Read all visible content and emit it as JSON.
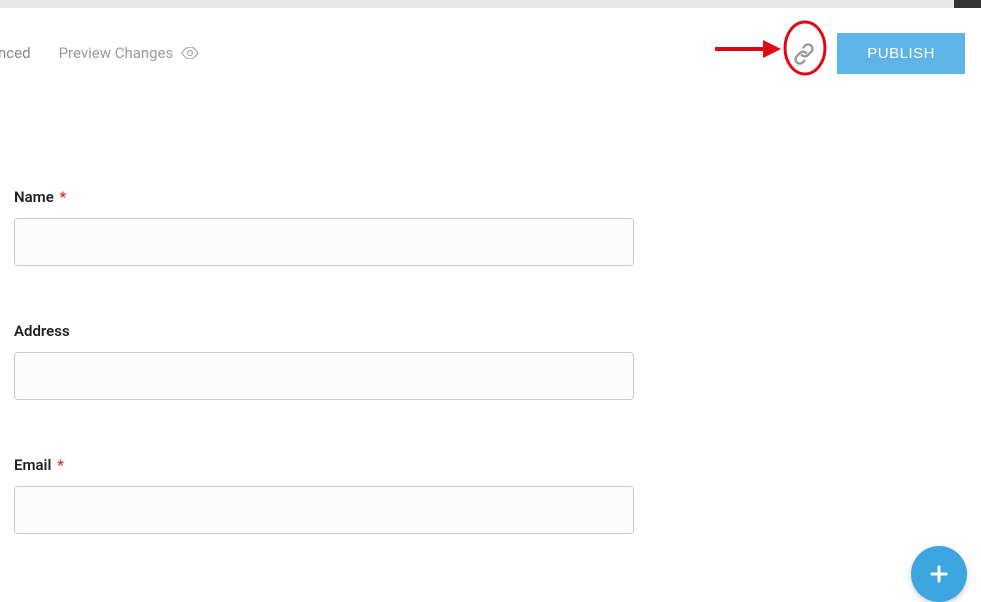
{
  "header": {
    "tab_partial": "nced",
    "preview_label": "Preview Changes",
    "publish_label": "PUBLISH"
  },
  "form": {
    "fields": [
      {
        "label": "Name",
        "required": true
      },
      {
        "label": "Address",
        "required": false
      },
      {
        "label": "Email",
        "required": true
      }
    ]
  },
  "annotations": {
    "arrow_color": "#e30613",
    "circle_color": "#e30613"
  }
}
